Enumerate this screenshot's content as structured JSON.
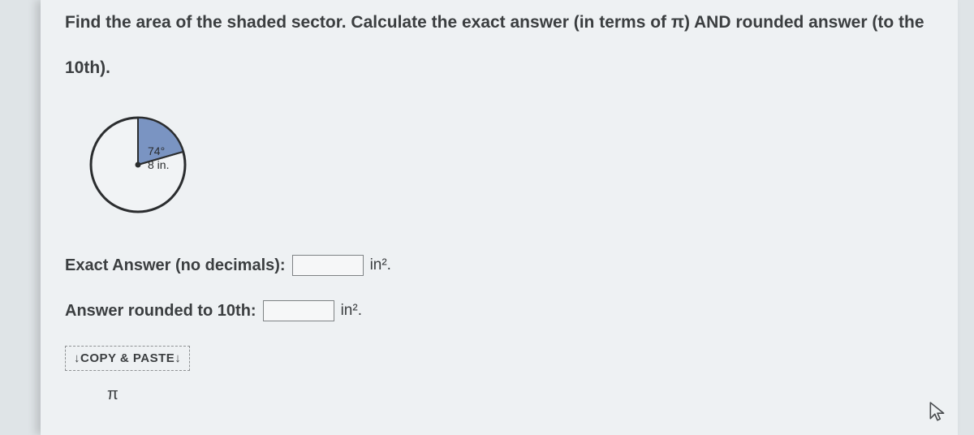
{
  "question": {
    "line1": "Find the area of the shaded sector. Calculate the exact answer (in terms of π) AND rounded answer (to the",
    "line2": "10th)."
  },
  "diagram": {
    "angle_label": "74°",
    "radius_label": "8 in."
  },
  "exact": {
    "label": "Exact  Answer (no decimals):",
    "value": "",
    "unit": "in².",
    "unit_aria": "inches squared"
  },
  "rounded": {
    "label": "Answer rounded to 10th:",
    "value": "",
    "unit": "in².",
    "unit_aria": "inches squared"
  },
  "copy_paste_label": "↓COPY & PASTE↓",
  "pi_symbol": "π"
}
